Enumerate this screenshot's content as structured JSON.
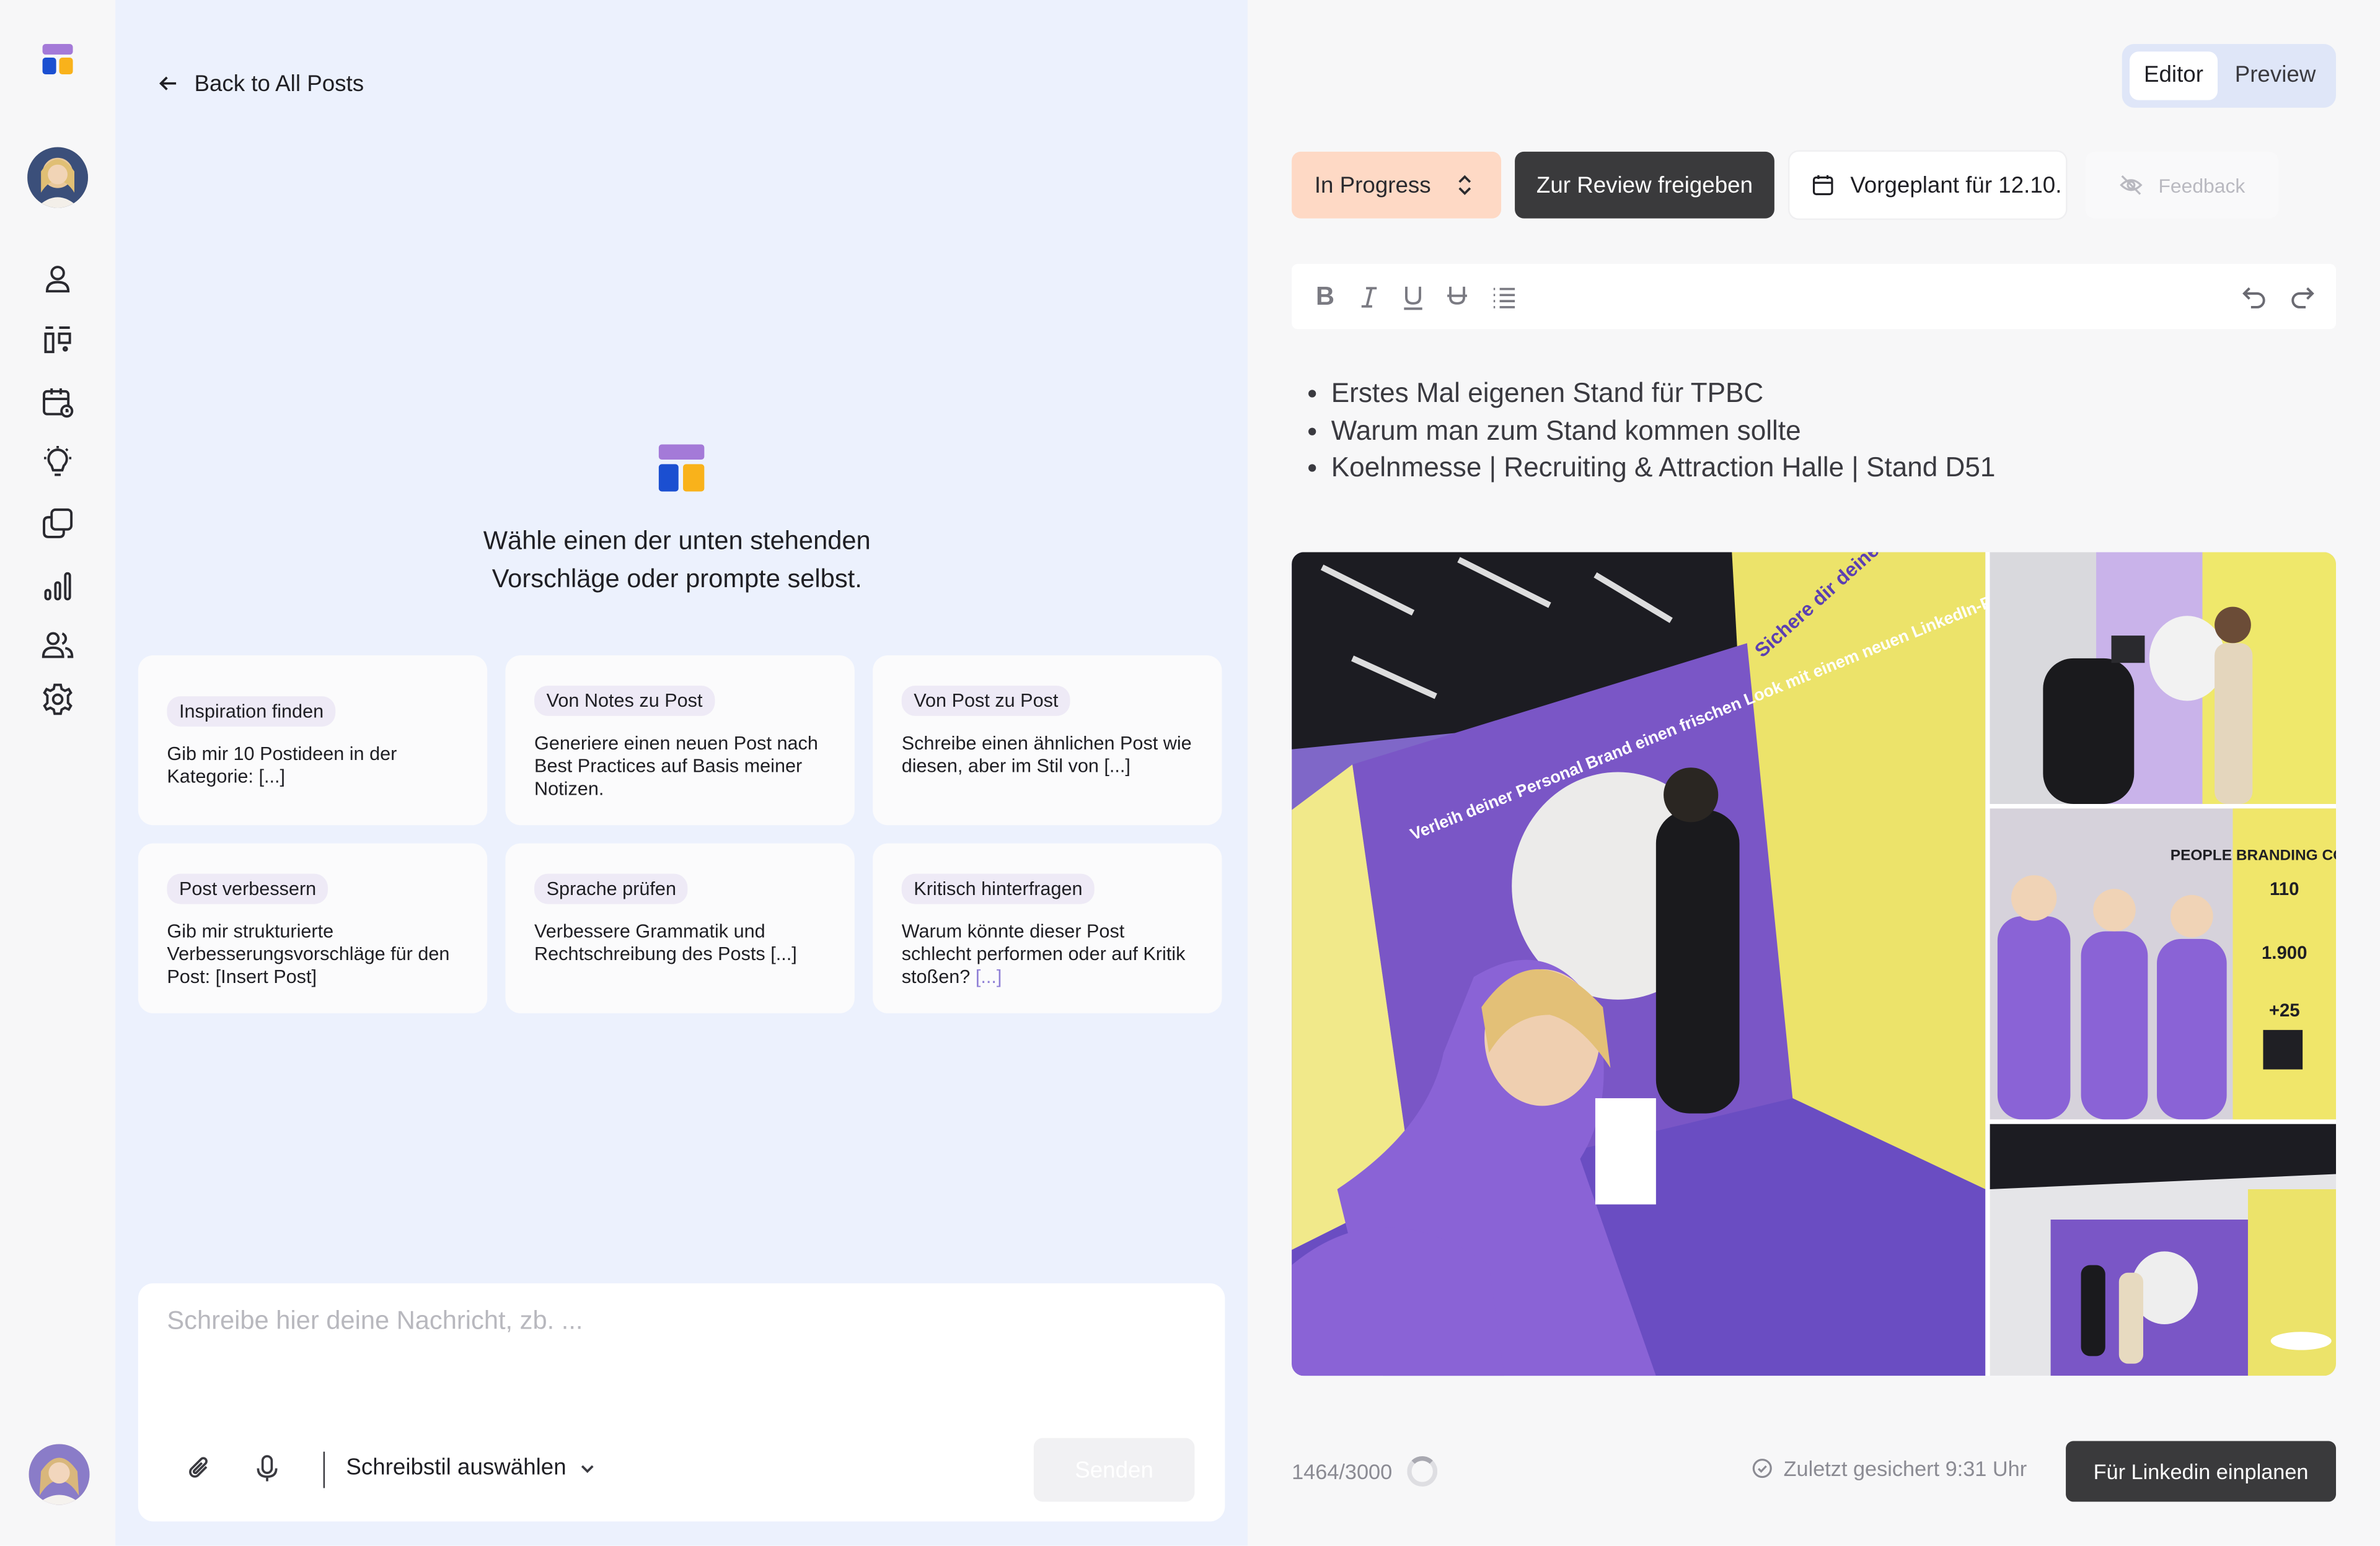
{
  "sidebar": {
    "icons": [
      "user-icon",
      "board-icon",
      "calendar-icon",
      "lightbulb-icon",
      "copy-icon",
      "chart-icon",
      "users-icon",
      "gear-icon"
    ]
  },
  "chat": {
    "back_label": "Back to All Posts",
    "prompt_title": "Wähle einen der unten stehenden Vorschläge oder prompte selbst.",
    "suggestions": [
      {
        "tag": "Inspiration finden",
        "desc": "Gib mir 10 Postideen in der Kategorie: [...]"
      },
      {
        "tag": "Von Notes zu Post",
        "desc": "Generiere einen neuen Post nach Best Practices auf Basis meiner Notizen."
      },
      {
        "tag": "Von Post zu Post",
        "desc": "Schreibe einen ähnlichen Post wie diesen, aber im Stil von [...]"
      },
      {
        "tag": "Post verbessern",
        "desc": "Gib mir strukturierte Verbesserungsvorschläge für den Post: [Insert Post]"
      },
      {
        "tag": "Sprache prüfen",
        "desc": "Verbessere Grammatik und Rechtschreibung des Posts [...]"
      },
      {
        "tag": "Kritisch hinterfragen",
        "desc": "Warum könnte dieser Post schlecht performen oder auf Kritik stoßen?",
        "desc_muted": "[...]"
      }
    ],
    "composer": {
      "placeholder": "Schreibe hier deine Nachricht, zb. ...",
      "style_label": "Schreibstil auswählen",
      "send_label": "Senden"
    }
  },
  "editor": {
    "toggle": {
      "editor": "Editor",
      "preview": "Preview"
    },
    "status": "In Progress",
    "review_label": "Zur Review freigeben",
    "scheduled_label": "Vorgeplant für 12.10.",
    "feedback_label": "Feedback",
    "bullets": [
      "Erstes Mal eigenen Stand für TPBC",
      "Warum man zum Stand kommen sollte",
      "Koelnmesse | Recruiting & Attraction Halle | Stand D51"
    ],
    "photo_text": {
      "booth_slogan": "Verleih deiner Personal Brand einen frischen Look mit einem neuen LinkedIn-Profilbild.",
      "banner": "Sichere dir deinen neuen LinkedIn-Profilbild",
      "brand": "PEOPLE BRANDING COMPANY",
      "stat_1": "110",
      "stat_2": "1.900",
      "stat_3": "+25"
    },
    "counter": "1464/3000",
    "saved_label": "Zuletzt gesichert 9:31 Uhr",
    "schedule_button": "Für Linkedin einplanen"
  }
}
